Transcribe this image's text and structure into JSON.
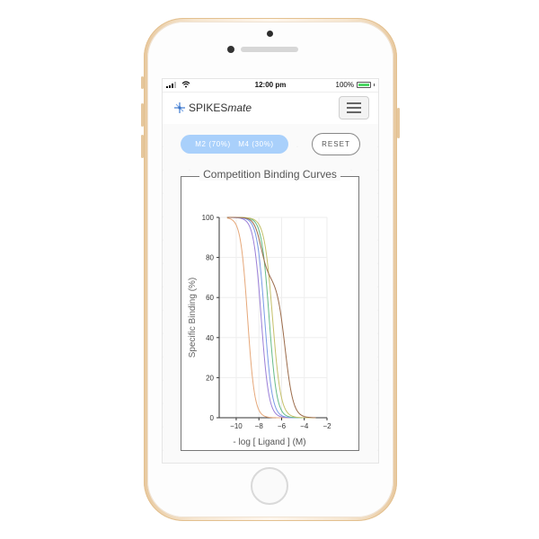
{
  "status_bar": {
    "time": "12:00 pm",
    "battery": "100%",
    "battery_level": 1.0
  },
  "navbar": {
    "brand_prefix": "SPIKES",
    "brand_suffix": "mate",
    "logo_icon": "spike-logo-icon",
    "menu_icon": "hamburger-icon"
  },
  "controls": {
    "selection_pill": "M2 (70%)   M4 (30%)",
    "reset_label": "RESET"
  },
  "panel": {
    "title": "Competition Binding Curves"
  },
  "colors": {
    "pill_bg": "#a9d0fb",
    "battery_green": "#4cd964",
    "series": [
      "#e6a87a",
      "#9b7fd8",
      "#7a9be6",
      "#66bb88",
      "#c6c06a",
      "#9b6b4a"
    ]
  },
  "chart_data": {
    "type": "line",
    "title": "",
    "xlabel": "- log [ Ligand ] (M)",
    "ylabel": "Specific Binding (%)",
    "xlim": [
      -11.5,
      -2
    ],
    "ylim": [
      0,
      100
    ],
    "x_ticks": [
      -10,
      -8,
      -6,
      -4,
      -2
    ],
    "y_ticks": [
      0,
      20,
      40,
      60,
      80,
      100
    ],
    "grid": true,
    "legend": "none",
    "series": [
      {
        "color": "#e6a87a",
        "curve": [
          {
            "logIC50": -9.0,
            "hill": 1.4
          }
        ]
      },
      {
        "color": "#9b7fd8",
        "curve": [
          {
            "logIC50": -7.8,
            "hill": 1.3
          }
        ]
      },
      {
        "color": "#7a9be6",
        "curve": [
          {
            "logIC50": -7.5,
            "hill": 1.3
          }
        ]
      },
      {
        "color": "#66bb88",
        "curve": [
          {
            "logIC50": -7.1,
            "hill": 1.3
          }
        ]
      },
      {
        "color": "#c6c06a",
        "curve": [
          {
            "logIC50": -6.8,
            "hill": 1.2
          }
        ]
      },
      {
        "color": "#9b6b4a",
        "curve": [
          {
            "logIC50": -7.8,
            "hill": 1.4,
            "fraction": 0.3
          },
          {
            "logIC50": -5.7,
            "hill": 1.2,
            "fraction": 0.7
          }
        ]
      }
    ]
  }
}
